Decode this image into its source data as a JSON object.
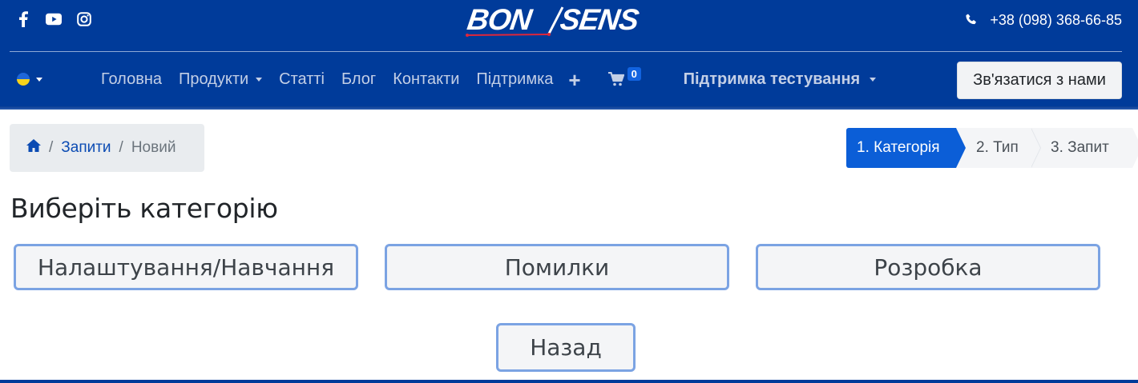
{
  "header": {
    "social": [
      "facebook-icon",
      "youtube-icon",
      "instagram-icon"
    ],
    "logo_text": "BON SENS",
    "phone": "+38 (098) 368-66-85",
    "language_flag": "ua-flag",
    "nav": {
      "home": "Головна",
      "products": "Продукти",
      "articles": "Статті",
      "blog": "Блог",
      "contacts": "Контакти",
      "support": "Підтримка",
      "cart_count": "0",
      "testing_support": "Підтримка тестування"
    },
    "contact_button": "Зв'язатися з нами",
    "colors": {
      "header_bg": "#003b9a",
      "nav_text": "#c3cfe6",
      "accent": "#0b5ed7"
    }
  },
  "breadcrumb": {
    "home_icon": "home-icon",
    "items": [
      "Запити",
      "Новий"
    ]
  },
  "steps": [
    "1. Категорія",
    "2. Тип",
    "3. Запит"
  ],
  "main": {
    "title": "Виберіть категорію",
    "categories": [
      "Налаштування/Навчання",
      "Помилки",
      "Розробка"
    ],
    "back": "Назад"
  }
}
